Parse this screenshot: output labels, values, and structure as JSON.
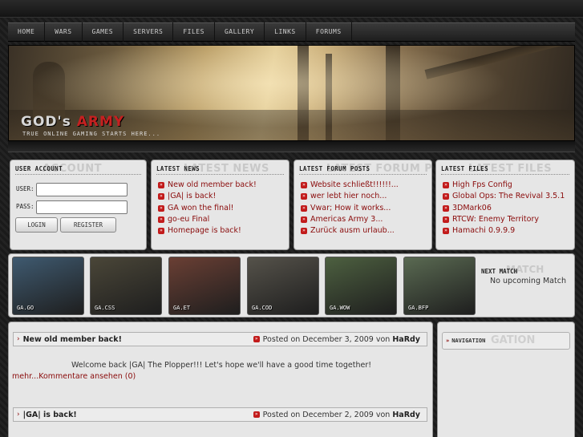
{
  "nav": [
    "HOME",
    "WARS",
    "GAMES",
    "SERVERS",
    "FILES",
    "GALLERY",
    "LINKS",
    "FORUMS"
  ],
  "banner": {
    "logo_main": "GOD's",
    "logo_accent": "ARMY",
    "tagline": "TRUE ONLINE GAMING STARTS HERE..."
  },
  "user_account": {
    "title": "USER ACCOUNT",
    "ghost": "ACCOUNT",
    "user_label": "USER:",
    "pass_label": "PASS:",
    "login": "LOGIN",
    "register": "REGISTER"
  },
  "latest_news": {
    "title": "LATEST NEWS",
    "ghost": "LATEST NEWS",
    "items": [
      "New old member back!",
      "|GA| is back!",
      "GA won the final!",
      "go-eu Final",
      "Homepage is back!"
    ]
  },
  "forum_posts": {
    "title": "LATEST FORUM POSTS",
    "ghost": "LATEST FORUM POSTS",
    "items": [
      "Website schließt!!!!!!...",
      "wer lebt hier noch...",
      "Vwar; How it works...",
      "Americas Army 3...",
      "Zurück ausm urlaub..."
    ]
  },
  "latest_files": {
    "title": "LATEST FILES",
    "ghost": "LATEST FILES",
    "items": [
      "High Fps Config",
      "Global Ops: The Revival 3.5.1",
      "3DMark06",
      "RTCW: Enemy Territory",
      "Hamachi 0.9.9.9"
    ]
  },
  "games": [
    {
      "caption": "GA.GO",
      "color": "#3f5a70"
    },
    {
      "caption": "GA.CSS",
      "color": "#4a4638"
    },
    {
      "caption": "GA.ET",
      "color": "#6a3f34"
    },
    {
      "caption": "GA.COD",
      "color": "#55524a"
    },
    {
      "caption": "GA.WOW",
      "color": "#4d6040"
    },
    {
      "caption": "GA.BFP",
      "color": "#5a6a52"
    }
  ],
  "next_match": {
    "title": "NEXT MATCH",
    "ghost": "MATCH",
    "text": "No upcoming Match"
  },
  "posts": [
    {
      "title": "New old member back!",
      "posted": "Posted on December 3, 2009 von",
      "author": "HaRdy",
      "body": "Welcome back |GA| The Plopper!!! Let's hope we'll have a good time together!",
      "link": "mehr...Kommentare ansehen (0)"
    },
    {
      "title": "|GA| is back!",
      "posted": "Posted on December 2, 2009 von",
      "author": "HaRdy"
    }
  ],
  "navigation": {
    "title": "NAVIGATION",
    "ghost": "GATION"
  }
}
